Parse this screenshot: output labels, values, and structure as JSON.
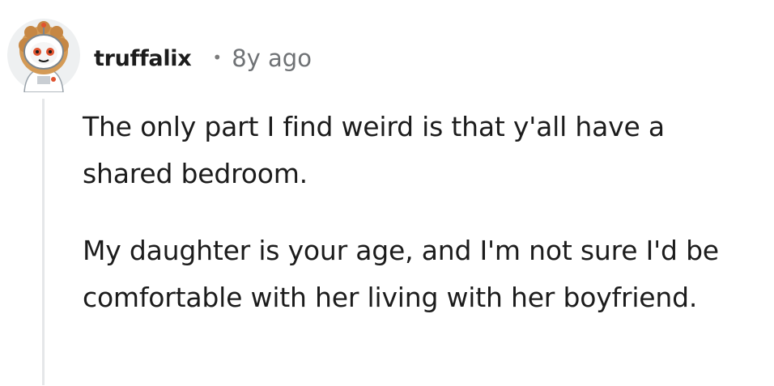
{
  "comment": {
    "author": "truffalix",
    "separator": "•",
    "age": "8y ago",
    "paragraphs": [
      "The only part I find weird is that y'all have a shared bedroom.",
      "My daughter is your age, and I'm not sure I'd be comfortable with her living with her boyfriend."
    ]
  },
  "avatar_icon": "snoo-astronaut-avatar-icon",
  "colors": {
    "text": "#1c1c1c",
    "meta": "#6f7275",
    "thread_line": "#e5e7e9"
  }
}
